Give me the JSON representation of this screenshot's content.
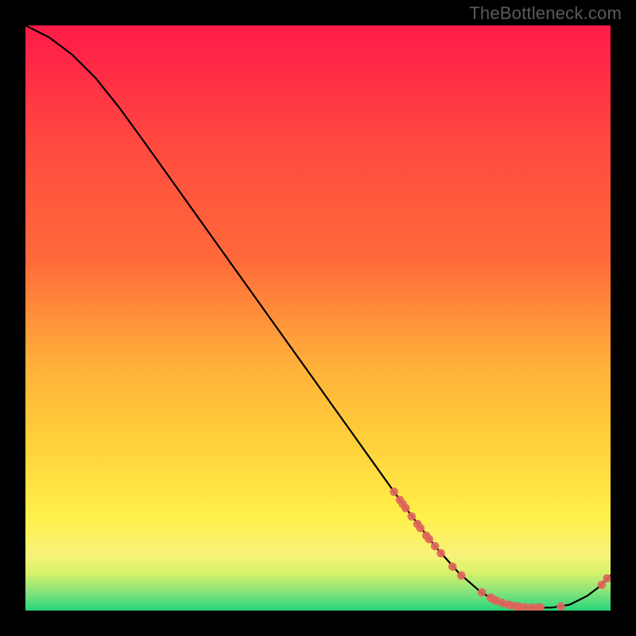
{
  "watermark": "TheBottleneck.com",
  "colors": {
    "bg": "#000000",
    "curve": "#000000",
    "marker": "#e0655b",
    "grad_top": "#ff1a49",
    "grad_mid1": "#ff6a3a",
    "grad_mid2": "#ffd23a",
    "grad_mid3": "#fff04a",
    "grad_band": "#d9f26a",
    "grad_bottom": "#28d67c"
  },
  "chart_data": {
    "type": "line",
    "title": "",
    "xlabel": "",
    "ylabel": "",
    "xlim": [
      0,
      100
    ],
    "ylim": [
      0,
      100
    ],
    "grid": false,
    "legend": false,
    "curve": [
      {
        "x": 0,
        "y": 100
      },
      {
        "x": 4,
        "y": 98
      },
      {
        "x": 8,
        "y": 95
      },
      {
        "x": 12,
        "y": 91
      },
      {
        "x": 16,
        "y": 86
      },
      {
        "x": 20,
        "y": 80.5
      },
      {
        "x": 25,
        "y": 73.5
      },
      {
        "x": 30,
        "y": 66.5
      },
      {
        "x": 35,
        "y": 59.5
      },
      {
        "x": 40,
        "y": 52.5
      },
      {
        "x": 45,
        "y": 45.5
      },
      {
        "x": 50,
        "y": 38.5
      },
      {
        "x": 55,
        "y": 31.5
      },
      {
        "x": 60,
        "y": 24.5
      },
      {
        "x": 65,
        "y": 17.5
      },
      {
        "x": 70,
        "y": 11
      },
      {
        "x": 74,
        "y": 6.5
      },
      {
        "x": 78,
        "y": 3
      },
      {
        "x": 82,
        "y": 1
      },
      {
        "x": 86,
        "y": 0.5
      },
      {
        "x": 90,
        "y": 0.5
      },
      {
        "x": 93,
        "y": 1
      },
      {
        "x": 96,
        "y": 2.5
      },
      {
        "x": 98,
        "y": 4
      },
      {
        "x": 100,
        "y": 6
      }
    ],
    "markers": [
      {
        "x": 63,
        "y": 20.3
      },
      {
        "x": 64,
        "y": 18.9
      },
      {
        "x": 64.5,
        "y": 18.2
      },
      {
        "x": 65,
        "y": 17.5
      },
      {
        "x": 66,
        "y": 16.1
      },
      {
        "x": 67,
        "y": 14.8
      },
      {
        "x": 67.5,
        "y": 14.1
      },
      {
        "x": 68.5,
        "y": 12.8
      },
      {
        "x": 69,
        "y": 12.2
      },
      {
        "x": 70,
        "y": 11
      },
      {
        "x": 71,
        "y": 9.8
      },
      {
        "x": 73,
        "y": 7.5
      },
      {
        "x": 74.5,
        "y": 6
      },
      {
        "x": 78,
        "y": 3.1
      },
      {
        "x": 79.5,
        "y": 2.2
      },
      {
        "x": 80,
        "y": 1.9
      },
      {
        "x": 80.5,
        "y": 1.7
      },
      {
        "x": 81.5,
        "y": 1.3
      },
      {
        "x": 82.5,
        "y": 1
      },
      {
        "x": 83,
        "y": 0.9
      },
      {
        "x": 84,
        "y": 0.7
      },
      {
        "x": 84.5,
        "y": 0.65
      },
      {
        "x": 85.5,
        "y": 0.55
      },
      {
        "x": 86.5,
        "y": 0.5
      },
      {
        "x": 87.5,
        "y": 0.5
      },
      {
        "x": 88,
        "y": 0.5
      },
      {
        "x": 91.5,
        "y": 0.7
      },
      {
        "x": 98.5,
        "y": 4.4
      },
      {
        "x": 99.4,
        "y": 5.5
      }
    ]
  }
}
